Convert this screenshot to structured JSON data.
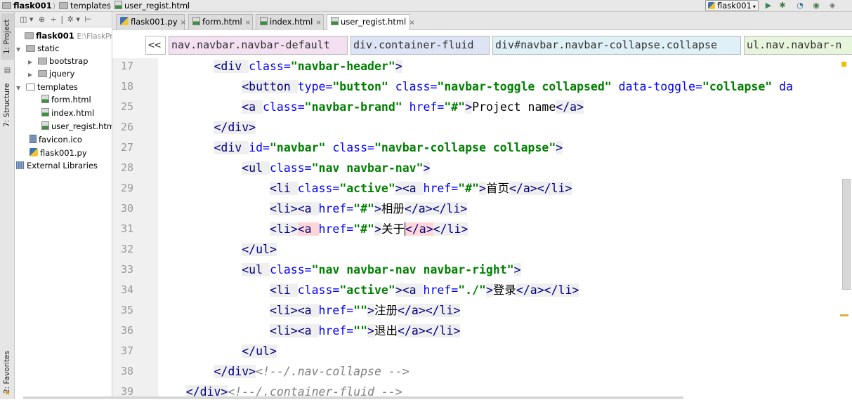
{
  "nav_bar": {
    "items": [
      "flask001",
      "templates",
      "user_regist.html"
    ],
    "run_config": "flask001"
  },
  "tool_windows": {
    "project": "1: Project",
    "structure": "7: Structure",
    "favorites": "2: Favorites"
  },
  "project_tree": {
    "root_name": "flask001",
    "root_path": "E:\\FlaskProjec",
    "nodes": [
      "static",
      "bootstrap",
      "jquery",
      "templates",
      "form.html",
      "index.html",
      "user_regist.html",
      "favicon.ico",
      "flask001.py",
      "External Libraries"
    ]
  },
  "editor_tabs": [
    {
      "label": "flask001.py",
      "icon": "py-file-icon",
      "active": false
    },
    {
      "label": "form.html",
      "icon": "html-file-icon",
      "active": false
    },
    {
      "label": "index.html",
      "icon": "html-file-icon",
      "active": false
    },
    {
      "label": "user_regist.html",
      "icon": "html-file-icon",
      "active": true
    }
  ],
  "breadcrumb": {
    "back": "<<",
    "items": [
      "nav.navbar.navbar-default",
      "div.container-fluid",
      "div#navbar.navbar-collapse.collapse",
      "ul.nav.navbar-n"
    ],
    "colors": [
      "#f3e0f0",
      "#dde4f6",
      "#dff0f6",
      "#e8f5dd"
    ]
  },
  "code_lines": [
    {
      "num": "17",
      "fold": "-",
      "tokens": [
        {
          "t": "        "
        },
        {
          "c": "tg",
          "t": "<div "
        },
        {
          "c": "at",
          "t": "class="
        },
        {
          "c": "vl",
          "t": "\"navbar-header\""
        },
        {
          "c": "tg",
          "t": ">"
        }
      ]
    },
    {
      "num": "18",
      "fold": "+",
      "tokens": [
        {
          "t": "            "
        },
        {
          "c": "tg",
          "t": "<button "
        },
        {
          "c": "at",
          "t": "type="
        },
        {
          "c": "vl",
          "t": "\"button\" "
        },
        {
          "c": "at",
          "t": "class="
        },
        {
          "c": "vl",
          "t": "\"navbar-toggle collapsed\" "
        },
        {
          "c": "at",
          "t": "data-toggle="
        },
        {
          "c": "vl",
          "t": "\"collapse\" "
        },
        {
          "c": "at",
          "t": "da"
        }
      ]
    },
    {
      "num": "25",
      "fold": "",
      "tokens": [
        {
          "t": "            "
        },
        {
          "c": "tg",
          "t": "<a "
        },
        {
          "c": "at",
          "t": "class="
        },
        {
          "c": "vl",
          "t": "\"navbar-brand\" "
        },
        {
          "c": "at",
          "t": "href="
        },
        {
          "c": "vl",
          "t": "\"#\""
        },
        {
          "c": "tg",
          "t": ">"
        },
        {
          "c": "tx",
          "t": "Project name"
        },
        {
          "c": "tg",
          "t": "</a>"
        }
      ]
    },
    {
      "num": "26",
      "fold": "-",
      "tokens": [
        {
          "t": "        "
        },
        {
          "c": "tg",
          "t": "</div>"
        }
      ]
    },
    {
      "num": "27",
      "fold": "-",
      "tokens": [
        {
          "t": "        "
        },
        {
          "c": "tg",
          "t": "<div "
        },
        {
          "c": "at",
          "t": "id="
        },
        {
          "c": "vl",
          "t": "\"navbar\" "
        },
        {
          "c": "at",
          "t": "class="
        },
        {
          "c": "vl",
          "t": "\"navbar-collapse collapse\""
        },
        {
          "c": "tg",
          "t": ">"
        }
      ]
    },
    {
      "num": "28",
      "fold": "-",
      "tokens": [
        {
          "t": "            "
        },
        {
          "c": "tg",
          "t": "<ul "
        },
        {
          "c": "at",
          "t": "class="
        },
        {
          "c": "vl",
          "t": "\"nav navbar-nav\""
        },
        {
          "c": "tg",
          "t": ">"
        }
      ]
    },
    {
      "num": "29",
      "fold": "",
      "tokens": [
        {
          "t": "                "
        },
        {
          "c": "tg",
          "t": "<li "
        },
        {
          "c": "at",
          "t": "class="
        },
        {
          "c": "vl",
          "t": "\"active\""
        },
        {
          "c": "tg",
          "t": "><a "
        },
        {
          "c": "at",
          "t": "href="
        },
        {
          "c": "vl",
          "t": "\"#\""
        },
        {
          "c": "tg",
          "t": ">"
        },
        {
          "c": "tx",
          "t": "首页"
        },
        {
          "c": "tg",
          "t": "</a></li>"
        }
      ]
    },
    {
      "num": "30",
      "fold": "",
      "tokens": [
        {
          "t": "                "
        },
        {
          "c": "tg",
          "t": "<li><a "
        },
        {
          "c": "at",
          "t": "href="
        },
        {
          "c": "vl",
          "t": "\"#\""
        },
        {
          "c": "tg",
          "t": ">"
        },
        {
          "c": "tx",
          "t": "相册"
        },
        {
          "c": "tg",
          "t": "</a></li>"
        }
      ]
    },
    {
      "num": "31",
      "fold": "",
      "current": true,
      "tokens": [
        {
          "t": "                "
        },
        {
          "c": "tg",
          "t": "<li>"
        },
        {
          "c": "tg hl",
          "t": "<a "
        },
        {
          "c": "at",
          "t": "href="
        },
        {
          "c": "vl",
          "t": "\"#\""
        },
        {
          "c": "tg",
          "t": ">"
        },
        {
          "c": "tx",
          "t": "关于"
        },
        {
          "c": "tg hl caret",
          "t": "</a>"
        },
        {
          "c": "tg",
          "t": "</li>"
        }
      ]
    },
    {
      "num": "32",
      "fold": "-",
      "tokens": [
        {
          "t": "            "
        },
        {
          "c": "tg",
          "t": "</ul>"
        }
      ]
    },
    {
      "num": "33",
      "fold": "-",
      "tokens": [
        {
          "t": "            "
        },
        {
          "c": "tg",
          "t": "<ul "
        },
        {
          "c": "at",
          "t": "class="
        },
        {
          "c": "vl",
          "t": "\"nav navbar-nav navbar-right\""
        },
        {
          "c": "tg",
          "t": ">"
        }
      ]
    },
    {
      "num": "34",
      "fold": "",
      "tokens": [
        {
          "t": "                "
        },
        {
          "c": "tg",
          "t": "<li "
        },
        {
          "c": "at",
          "t": "class="
        },
        {
          "c": "vl",
          "t": "\"active\""
        },
        {
          "c": "tg",
          "t": "><a "
        },
        {
          "c": "at",
          "t": "href="
        },
        {
          "c": "vl",
          "t": "\"./\""
        },
        {
          "c": "tg",
          "t": ">"
        },
        {
          "c": "tx",
          "t": "登录"
        },
        {
          "c": "tg",
          "t": "</a></li>"
        }
      ]
    },
    {
      "num": "35",
      "fold": "",
      "tokens": [
        {
          "t": "                "
        },
        {
          "c": "tg",
          "t": "<li><a "
        },
        {
          "c": "at",
          "t": "href="
        },
        {
          "c": "vl",
          "t": "\"\""
        },
        {
          "c": "tg",
          "t": ">"
        },
        {
          "c": "tx",
          "t": "注册"
        },
        {
          "c": "tg",
          "t": "</a></li>"
        }
      ]
    },
    {
      "num": "36",
      "fold": "",
      "tokens": [
        {
          "t": "                "
        },
        {
          "c": "tg",
          "t": "<li><a "
        },
        {
          "c": "at",
          "t": "href="
        },
        {
          "c": "vl",
          "t": "\"\""
        },
        {
          "c": "tg",
          "t": ">"
        },
        {
          "c": "tx",
          "t": "退出"
        },
        {
          "c": "tg",
          "t": "</a></li>"
        }
      ]
    },
    {
      "num": "37",
      "fold": "-",
      "tokens": [
        {
          "t": "            "
        },
        {
          "c": "tg",
          "t": "</ul>"
        }
      ]
    },
    {
      "num": "38",
      "fold": "-",
      "tokens": [
        {
          "t": "        "
        },
        {
          "c": "tg",
          "t": "</div>"
        },
        {
          "c": "cm",
          "t": "<!--/.nav-collapse -->"
        }
      ]
    },
    {
      "num": "39",
      "fold": "-",
      "tokens": [
        {
          "t": "    "
        },
        {
          "c": "tg",
          "t": "</div>"
        },
        {
          "c": "cm",
          "t": "<!--/.container-fluid -->"
        }
      ]
    }
  ]
}
